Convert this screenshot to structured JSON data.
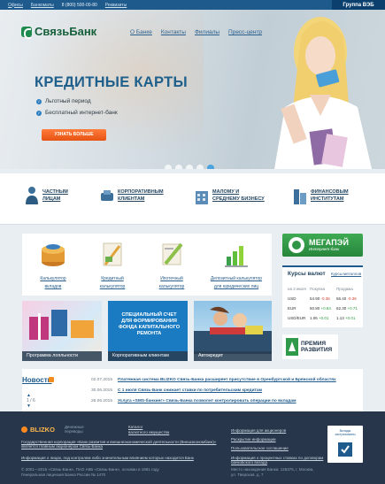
{
  "topbar": {
    "links": [
      "Офисы",
      "Банкоматы"
    ],
    "phone": "8 (800) 500-00-80",
    "requisites": "Реквизиты",
    "group": "Группа ВЭБ"
  },
  "logo": {
    "text": "СвязьБанк"
  },
  "nav": [
    "О Банке",
    "Контакты",
    "Филиалы",
    "Пресс-центр"
  ],
  "hero": {
    "title": "КРЕДИТНЫЕ КАРТЫ",
    "features": [
      "Льготный период",
      "Бесплатный интернет-банк"
    ],
    "button": "УЗНАТЬ БОЛЬШЕ",
    "slides": 5,
    "active_slide": 5
  },
  "categories": [
    {
      "l1": "ЧАСТНЫМ",
      "l2": "ЛИЦАМ",
      "icon": "person-icon"
    },
    {
      "l1": "КОРПОРАТИВНЫМ",
      "l2": "КЛИЕНТАМ",
      "icon": "handshake-icon"
    },
    {
      "l1": "МАЛОМУ И",
      "l2": "СРЕДНЕМУ БИЗНЕСУ",
      "icon": "office-icon"
    },
    {
      "l1": "ФИНАНСОВЫМ",
      "l2": "ИНСТИТУТАМ",
      "icon": "buildings-icon"
    }
  ],
  "calculators": [
    {
      "l1": "Калькулятор",
      "l2": "вкладов",
      "icon": "coins-icon"
    },
    {
      "l1": "Кредитный",
      "l2": "калькулятор",
      "icon": "notepad-icon"
    },
    {
      "l1": "Ипотечный",
      "l2": "калькулятор",
      "icon": "pencil-icon"
    },
    {
      "l1": "Депозитный калькулятор",
      "l2": "для юридических лиц",
      "icon": "bar-chart-icon"
    }
  ],
  "promos": [
    {
      "caption": "Программа лояльности"
    },
    {
      "caption": "Корпоративным клиентам",
      "text": "СПЕЦИАЛЬНЫЙ СЧЕТ ДЛЯ ФОРМИРОВАНИЯ ФОНДА КАПИТАЛЬНОГО РЕМОНТА"
    },
    {
      "caption": "Автокредит"
    }
  ],
  "megapay": {
    "title": "МЕГАПЭЙ",
    "subtitle": "Интернет-банк"
  },
  "rates": {
    "title": "Курсы валют",
    "tab": "Курсы металлов",
    "headers": [
      "на 2 июля",
      "Покупка",
      "Продажа"
    ],
    "rows": [
      {
        "cur": "USD",
        "buy": "54.90",
        "buy_d": "-0.36",
        "sell": "56.40",
        "sell_d": "-0.36"
      },
      {
        "cur": "EUR",
        "buy": "60.80",
        "buy_d": "+0.84",
        "sell": "62.30",
        "sell_d": "+0.71"
      },
      {
        "cur": "USD/EUR",
        "buy": "1.06",
        "buy_d": "+0.01",
        "sell": "1.13",
        "sell_d": "+0.01"
      }
    ]
  },
  "premia": {
    "l1": "ПРЕМИЯ",
    "l2": "РАЗВИТИЯ"
  },
  "news": {
    "title": "Новости",
    "pager": "1 / 6",
    "items": [
      {
        "date": "02.07.2015",
        "text": "Платежная система BLIZKO Связь-Банка расширяет присутствие в Оренбургской и Брянской областях"
      },
      {
        "date": "30.06.2015",
        "text": "С 1 июля Связь-Банк снижает ставки по потребительским кредитам"
      },
      {
        "date": "26.06.2015",
        "text": "Услуга «SMS-банкинг» Связь-Банка позволит контролировать операции по вкладам"
      }
    ]
  },
  "footer": {
    "blizko": "BLIZKO",
    "blizko_sub": "Денежные переводы",
    "catalog": "Каталог",
    "catalog2": "валютного имущества",
    "shareholders": "Информация для акционеров",
    "disclosure": "Раскрытие информации",
    "agreement": "Пользовательское соглашение",
    "rates_info": "Информация о процентных ставках по договорам банковского вклада",
    "gk": "Государственная корпорация «Банк развития и внешнеэкономической деятельности (Внешэкономбанк)» является главным акционером Связь-Банка",
    "persons": "Информация о лицах, под контролем либо значительным влиянием которых находится Банк",
    "copyright": "© 2001—2015 «Связь-Банк», ПАО АКБ «Связь-Банк», основан в 1991 году",
    "license": "Генеральная лицензия Банка России № 1470",
    "address1": "Место нахождения Банка: 125375, г. Москва,",
    "address2": "ул. Тверская, д. 7",
    "badge": "Вклады застрахованы"
  }
}
